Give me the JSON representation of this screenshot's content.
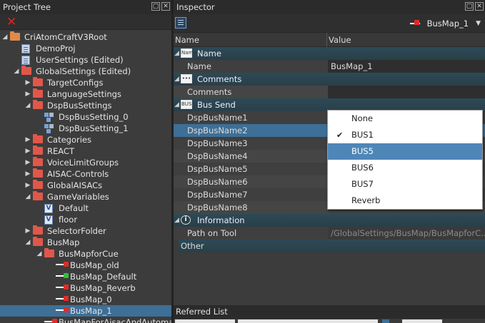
{
  "tree_panel": {
    "title": "Project Tree",
    "delete_icon": "x-icon",
    "items": [
      {
        "label": "CriAtomCraftV3Root",
        "icon": "folder-root-icon",
        "expanded": true,
        "depth": 0
      },
      {
        "label": "DemoProj",
        "icon": "project-doc-icon",
        "depth": 1
      },
      {
        "label": "UserSettings (Edited)",
        "icon": "project-doc-icon",
        "depth": 1
      },
      {
        "label": "GlobalSettings (Edited)",
        "icon": "folder-icon",
        "expanded": true,
        "depth": 1
      },
      {
        "label": "TargetConfigs",
        "icon": "folder-icon",
        "depth": 2
      },
      {
        "label": "LanguageSettings",
        "icon": "folder-icon",
        "depth": 2
      },
      {
        "label": "DspBusSettings",
        "icon": "folder-icon",
        "expanded": true,
        "depth": 2
      },
      {
        "label": "DspBusSetting_0",
        "icon": "bus-setting-icon",
        "depth": 3
      },
      {
        "label": "DspBusSetting_1",
        "icon": "bus-setting-icon",
        "depth": 3
      },
      {
        "label": "Categories",
        "icon": "folder-icon",
        "depth": 2
      },
      {
        "label": "REACT",
        "icon": "folder-icon",
        "depth": 2
      },
      {
        "label": "VoiceLimitGroups",
        "icon": "folder-icon",
        "depth": 2
      },
      {
        "label": "AISAC-Controls",
        "icon": "folder-icon",
        "depth": 2
      },
      {
        "label": "GlobalAISACs",
        "icon": "folder-icon",
        "depth": 2
      },
      {
        "label": "GameVariables",
        "icon": "folder-icon",
        "expanded": true,
        "depth": 2
      },
      {
        "label": "Default",
        "icon": "variable-icon",
        "depth": 3
      },
      {
        "label": "floor",
        "icon": "variable-icon",
        "depth": 3
      },
      {
        "label": "SelectorFolder",
        "icon": "folder-icon",
        "depth": 2
      },
      {
        "label": "BusMap",
        "icon": "folder-icon",
        "expanded": true,
        "depth": 2
      },
      {
        "label": "BusMapforCue",
        "icon": "folder-icon",
        "expanded": true,
        "depth": 3
      },
      {
        "label": "BusMap_old",
        "icon": "busmap-icon",
        "depth": 4
      },
      {
        "label": "BusMap_Default",
        "icon": "busmap-default-icon",
        "depth": 4
      },
      {
        "label": "BusMap_Reverb",
        "icon": "busmap-icon",
        "depth": 4
      },
      {
        "label": "BusMap_0",
        "icon": "busmap-icon",
        "depth": 4
      },
      {
        "label": "BusMap_1",
        "icon": "busmap-icon",
        "depth": 4,
        "selected": true
      },
      {
        "label": "BusMapForAisacAndAutomation",
        "icon": "busmap-icon",
        "depth": 3
      }
    ]
  },
  "inspector": {
    "title": "Inspector",
    "current_object": "BusMap_1",
    "columns": {
      "name": "Name",
      "value": "Value"
    },
    "categories": {
      "name": {
        "label": "Name",
        "icon_text": "Name"
      },
      "comments": {
        "label": "Comments"
      },
      "bus_send": {
        "label": "Bus Send",
        "icon_text": "BUS"
      },
      "information": {
        "label": "Information"
      },
      "other": {
        "label": "Other"
      }
    },
    "props": {
      "name": {
        "label": "Name",
        "value": "BusMap_1"
      },
      "comments": {
        "label": "Comments",
        "value": ""
      },
      "bus": [
        {
          "label": "DspBusName1"
        },
        {
          "label": "DspBusName2",
          "selected": true
        },
        {
          "label": "DspBusName3"
        },
        {
          "label": "DspBusName4"
        },
        {
          "label": "DspBusName5"
        },
        {
          "label": "DspBusName6"
        },
        {
          "label": "DspBusName7"
        },
        {
          "label": "DspBusName8"
        }
      ],
      "path": {
        "label": "Path on Tool",
        "value": "/GlobalSettings/BusMap/BusMapforC..."
      }
    },
    "dropdown": {
      "options": [
        "None",
        "BUS1",
        "BUS5",
        "BUS6",
        "BUS7",
        "Reverb"
      ],
      "checked": "BUS1",
      "highlighted": "BUS5"
    }
  },
  "referred_list": {
    "title": "Referred List"
  },
  "colors": {
    "selection": "#3e6f96",
    "category_bar": "#2c4a57",
    "folder": "#e0574a",
    "delete": "#e02424"
  }
}
